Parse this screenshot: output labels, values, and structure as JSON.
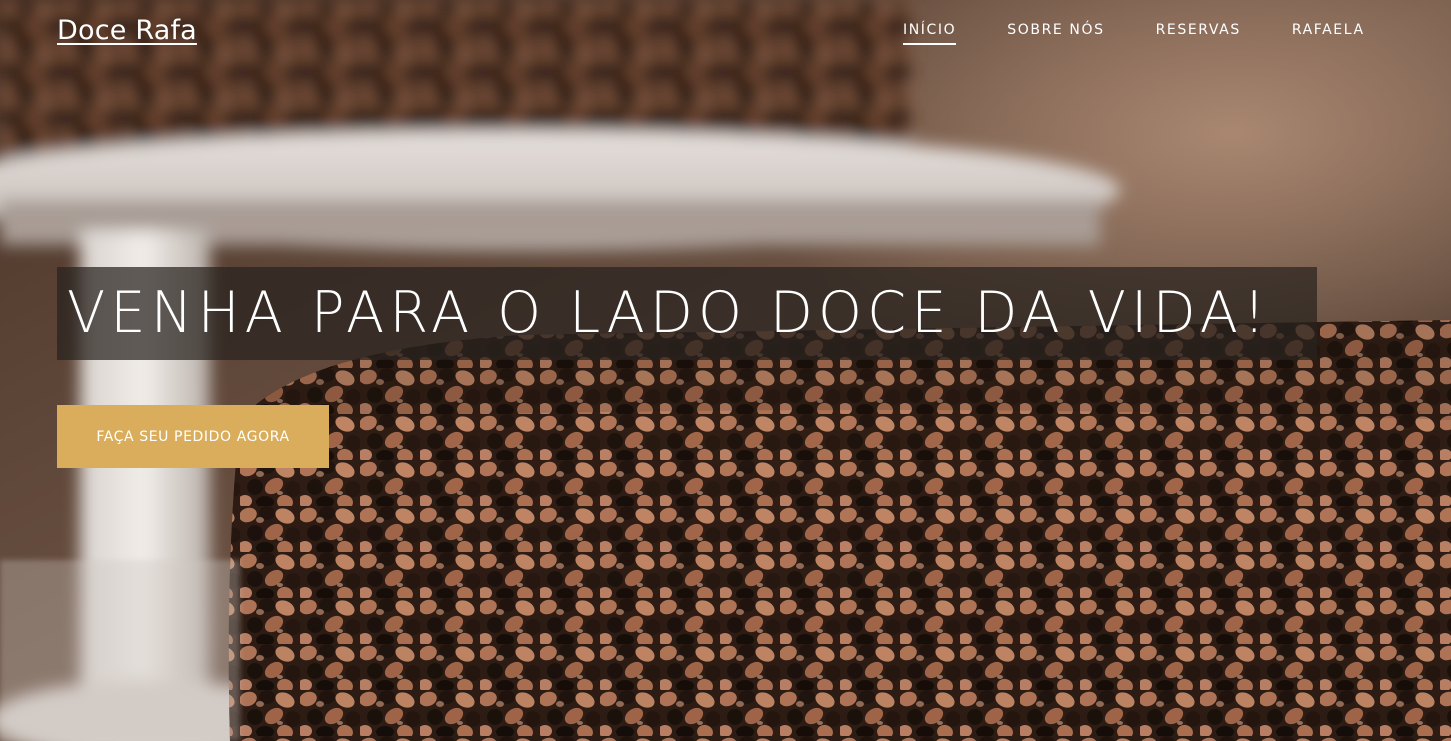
{
  "header": {
    "brand": "Doce Rafa",
    "nav": [
      {
        "label": "INÍCIO",
        "active": true
      },
      {
        "label": "SOBRE NÓS",
        "active": false
      },
      {
        "label": "RESERVAS",
        "active": false
      },
      {
        "label": "RAFAELA",
        "active": false
      }
    ]
  },
  "hero": {
    "headline": "VENHA PARA O LADO DOCE DA VIDA!",
    "cta_label": "FAÇA SEU PEDIDO AGORA",
    "background_image": "chocolate-sprinkle-cake"
  },
  "colors": {
    "cta_background": "#d9ad5c",
    "headline_box": "#28221e",
    "text": "#ffffff"
  }
}
